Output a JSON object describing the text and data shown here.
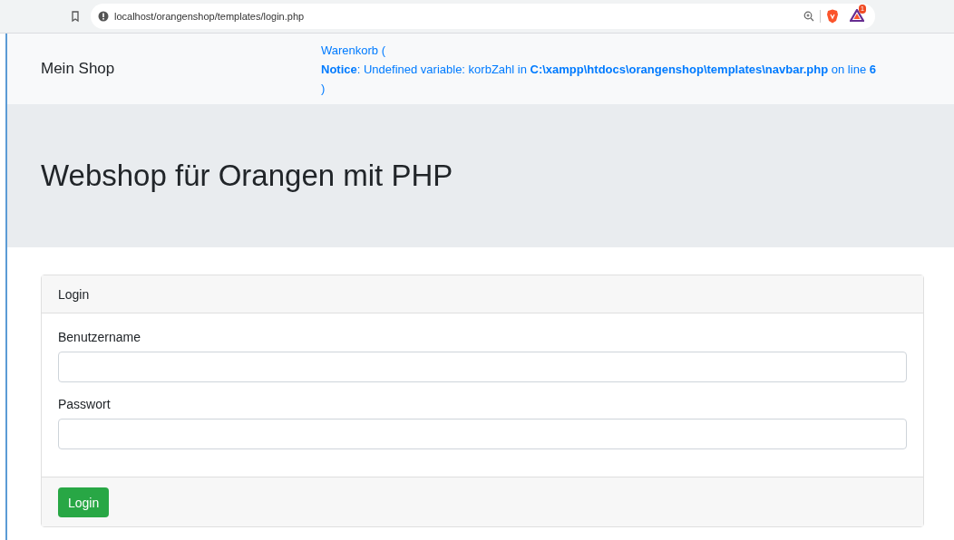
{
  "browser": {
    "url": "localhost/orangenshop/templates/login.php",
    "notification_badge": "1"
  },
  "navbar": {
    "brand": "Mein Shop",
    "cart_link_start": "Warenkorb (",
    "notice": "**Notice**: Undefined variable: korbZahl in **C:\\xampp\\htdocs\\orangenshop\\templates\\navbar.php** on line **6**",
    "cart_link_end": ")"
  },
  "jumbotron": {
    "heading": "Webshop für Orangen mit PHP"
  },
  "card": {
    "header": "Login",
    "fields": [
      {
        "label": "Benutzername"
      },
      {
        "label": "Passwort"
      }
    ],
    "button": "Login"
  }
}
